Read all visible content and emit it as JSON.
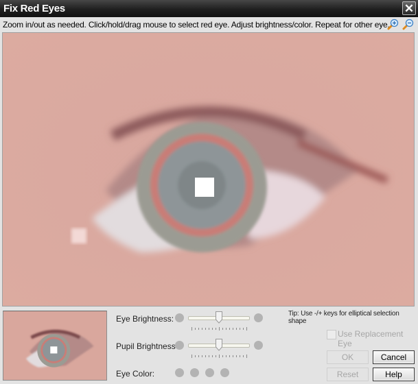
{
  "window": {
    "title": "Fix Red Eyes",
    "close_icon": "close-icon"
  },
  "toolbar": {
    "instructions": "Zoom in/out as needed. Click/hold/drag mouse to select red eye. Adjust brightness/color. Repeat for other eye.",
    "zoom_in_icon": "zoom-in-icon",
    "zoom_out_icon": "zoom-out-icon"
  },
  "image": {
    "subject": "close-up of eye with red-eye selection",
    "skin_color": "#d9a79d",
    "iris_color": "#8a9396",
    "ring_color": "#d0706a"
  },
  "controls": {
    "eye_brightness": {
      "label": "Eye Brightness:",
      "value": 0.5
    },
    "pupil_brightness": {
      "label": "Pupil Brightness",
      "value": 0.5
    },
    "eye_color": {
      "label": "Eye Color:",
      "swatches": [
        "#b3b3b3",
        "#b3b3b3",
        "#b3b3b3",
        "#b3b3b3"
      ]
    }
  },
  "tip": "Tip: Use -/+ keys for elliptical selection shape",
  "replacement": {
    "label": "Use Replacement Eye",
    "checked": false,
    "enabled": false
  },
  "buttons": {
    "ok": "OK",
    "cancel": "Cancel",
    "reset": "Reset",
    "help": "Help"
  }
}
